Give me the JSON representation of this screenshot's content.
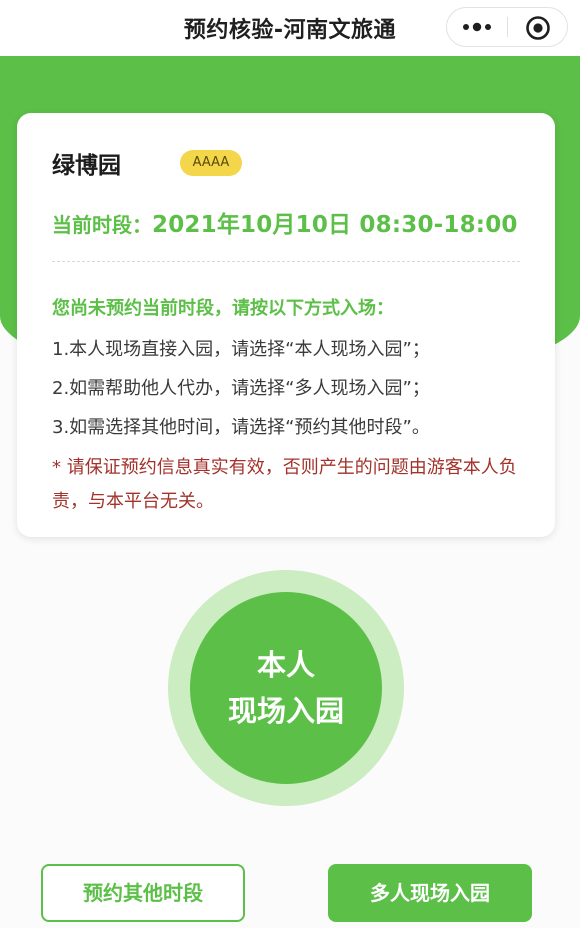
{
  "header": {
    "title": "预约核验-河南文旅通",
    "more_icon": "more-dots-icon",
    "close_icon": "target-circle-icon"
  },
  "colors": {
    "brand_green": "#5cbf48",
    "badge_yellow": "#f4d64a",
    "warning_red": "#a3322b"
  },
  "card": {
    "park_name": "绿博园",
    "grade_badge": "AAAA",
    "time_label": "当前时段：",
    "time_value": "2021年10月10日 08:30-18:00",
    "notice_heading": "您尚未预约当前时段，请按以下方式入场：",
    "steps": [
      "1.本人现场直接入园，请选择“本人现场入园”；",
      "2.如需帮助他人代办，请选择“多人现场入园”；",
      "3.如需选择其他时间，请选择“预约其他时段”。"
    ],
    "warning": "* 请保证预约信息真实有效，否则产生的问题由游客本人负责，与本平台无关。"
  },
  "main_button": {
    "line1": "本人",
    "line2": "现场入园"
  },
  "bottom_buttons": {
    "other_label": "预约其他时段",
    "multi_label": "多人现场入园"
  }
}
